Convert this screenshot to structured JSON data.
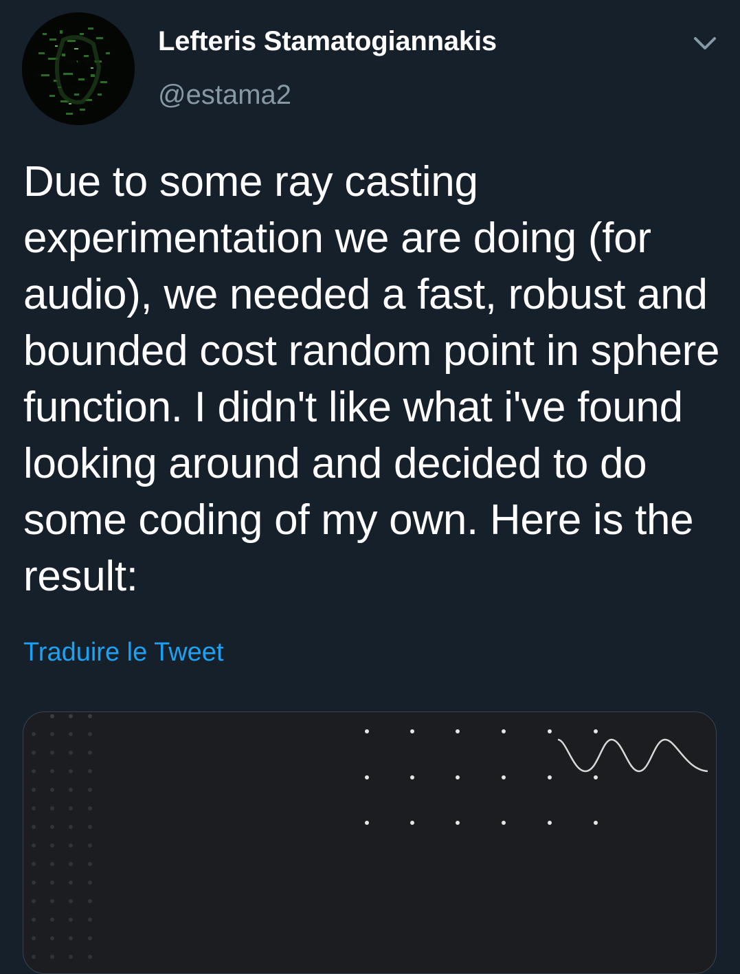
{
  "header": {
    "display_name": "Lefteris Stamatogiannakis",
    "handle": "@estama2",
    "avatar_icon": "avatar-image",
    "menu_icon": "chevron-down-icon"
  },
  "tweet": {
    "text": "Due to some ray casting experimentation we are doing (for audio), we needed a fast, robust and bounded cost random point in sphere function. I didn't like what i've found looking around and decided to do some coding of my own. Here is the result:",
    "translate_label": "Traduire le Tweet"
  },
  "media": {
    "type": "image-preview",
    "icon": "wave-pattern-image"
  },
  "colors": {
    "background": "#15202b",
    "text": "#ffffff",
    "secondary_text": "#8899a6",
    "link": "#1da1f2",
    "card_background": "#1b1d21",
    "card_border": "#38444d"
  }
}
